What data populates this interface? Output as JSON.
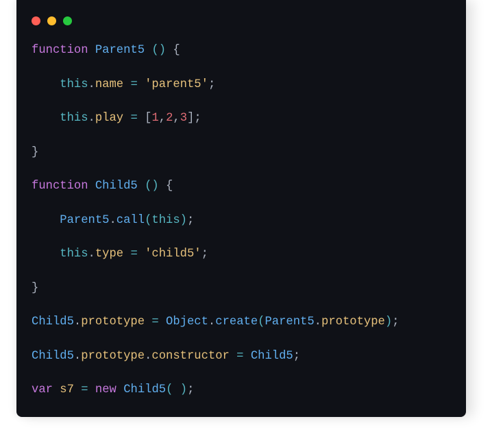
{
  "buttons": {
    "close": "close",
    "minimize": "minimize",
    "zoom": "zoom"
  },
  "code": {
    "t01": "function",
    "t02": "Parent5",
    "t03": "(",
    "t04": ")",
    "t05": "{",
    "t06": "this",
    "t07": ".",
    "t08": "name",
    "t09": "=",
    "t10": "'parent5'",
    "t11": ";",
    "t12": "this",
    "t13": ".",
    "t14": "play",
    "t15": "=",
    "t16": "[",
    "t17": "1",
    "t18": ",",
    "t19": "2",
    "t20": ",",
    "t21": "3",
    "t22": "]",
    "t23": ";",
    "t24": "}",
    "t25": "function",
    "t26": "Child5",
    "t27": "(",
    "t28": ")",
    "t29": "{",
    "t30": "Parent5",
    "t31": ".",
    "t32": "call",
    "t33": "(",
    "t34": "this",
    "t35": ")",
    "t36": ";",
    "t37": "this",
    "t38": ".",
    "t39": "type",
    "t40": "=",
    "t41": "'child5'",
    "t42": ";",
    "t43": "}",
    "t44": "Child5",
    "t45": ".",
    "t46": "prototype",
    "t47": "=",
    "t48": "Object",
    "t49": ".",
    "t50": "create",
    "t51": "(",
    "t52": "Parent5",
    "t53": ".",
    "t54": "prototype",
    "t55": ")",
    "t56": ";",
    "t57": "Child5",
    "t58": ".",
    "t59": "prototype",
    "t60": ".",
    "t61": "constructor",
    "t62": "=",
    "t63": "Child5",
    "t64": ";",
    "t65": "var",
    "t66": "s7",
    "t67": "=",
    "t68": "new",
    "t69": "Child5",
    "t70": "(",
    "t71": ")",
    "t72": ";"
  }
}
